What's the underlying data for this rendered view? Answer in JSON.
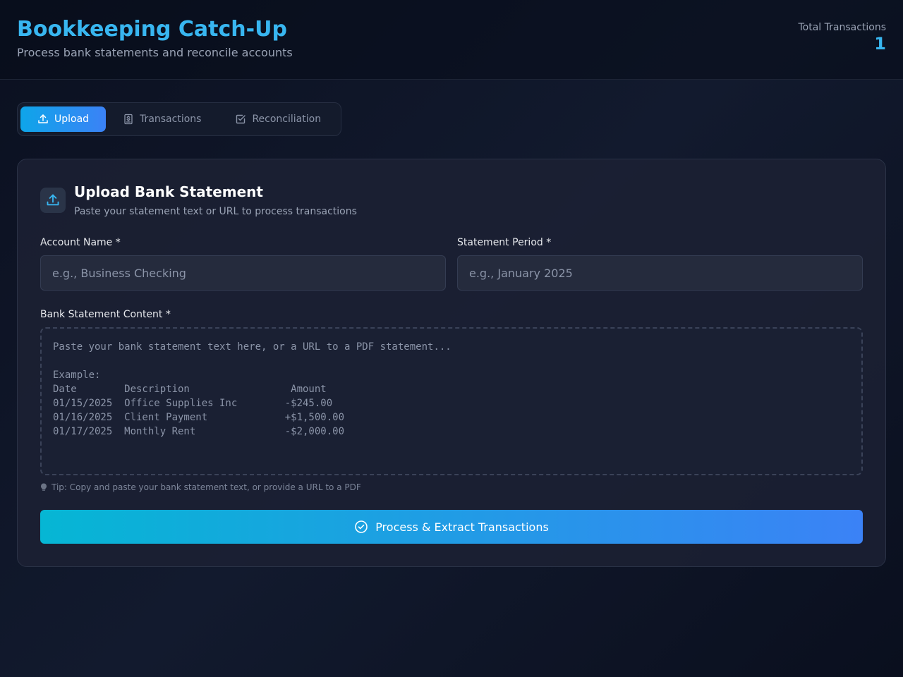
{
  "header": {
    "title": "Bookkeeping Catch-Up",
    "subtitle": "Process bank statements and reconcile accounts",
    "stats_label": "Total Transactions",
    "stats_value": "1"
  },
  "tabs": [
    {
      "label": "Upload",
      "icon": "upload-icon",
      "active": true
    },
    {
      "label": "Transactions",
      "icon": "dollar-document-icon",
      "active": false
    },
    {
      "label": "Reconciliation",
      "icon": "check-square-icon",
      "active": false
    }
  ],
  "upload": {
    "title": "Upload Bank Statement",
    "subtitle": "Paste your statement text or URL to process transactions",
    "account_label": "Account Name *",
    "account_placeholder": "e.g., Business Checking",
    "account_value": "",
    "period_label": "Statement Period *",
    "period_placeholder": "e.g., January 2025",
    "period_value": "",
    "content_label": "Bank Statement Content *",
    "content_placeholder": "Paste your bank statement text here, or a URL to a PDF statement...\n\nExample:\nDate        Description                 Amount\n01/15/2025  Office Supplies Inc        -$245.00\n01/16/2025  Client Payment             +$1,500.00\n01/17/2025  Monthly Rent               -$2,000.00",
    "content_value": "",
    "tip": "Tip: Copy and paste your bank statement text, or provide a URL to a PDF",
    "button_label": "Process & Extract Transactions"
  },
  "colors": {
    "accent": "#38b6f0",
    "button_gradient_start": "#06b6d4",
    "button_gradient_end": "#3b82f6"
  }
}
